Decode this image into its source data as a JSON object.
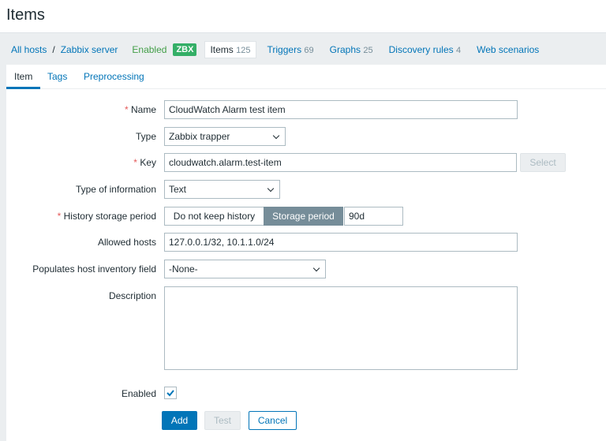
{
  "page_title": "Items",
  "breadcrumb": {
    "all_hosts": "All hosts",
    "separator": "/",
    "host": "Zabbix server",
    "status": "Enabled",
    "zbx": "ZBX"
  },
  "nav": [
    {
      "label": "Items",
      "count": "125"
    },
    {
      "label": "Triggers",
      "count": "69"
    },
    {
      "label": "Graphs",
      "count": "25"
    },
    {
      "label": "Discovery rules",
      "count": "4"
    },
    {
      "label": "Web scenarios",
      "count": ""
    }
  ],
  "tabs": [
    "Item",
    "Tags",
    "Preprocessing"
  ],
  "form": {
    "name_label": "Name",
    "name_value": "CloudWatch Alarm test item",
    "type_label": "Type",
    "type_value": "Zabbix trapper",
    "key_label": "Key",
    "key_value": "cloudwatch.alarm.test-item",
    "select_label": "Select",
    "info_label": "Type of information",
    "info_value": "Text",
    "history_label": "History storage period",
    "history_opt1": "Do not keep history",
    "history_opt2": "Storage period",
    "history_value": "90d",
    "allowed_label": "Allowed hosts",
    "allowed_value": "127.0.0.1/32, 10.1.1.0/24",
    "inventory_label": "Populates host inventory field",
    "inventory_value": "-None-",
    "description_label": "Description",
    "description_value": "",
    "enabled_label": "Enabled",
    "enabled_checked": true,
    "add": "Add",
    "test": "Test",
    "cancel": "Cancel"
  },
  "colors": {
    "accent": "#0275b8",
    "required": "#e45959",
    "enabled": "#429e47",
    "zbx": "#34af67"
  }
}
